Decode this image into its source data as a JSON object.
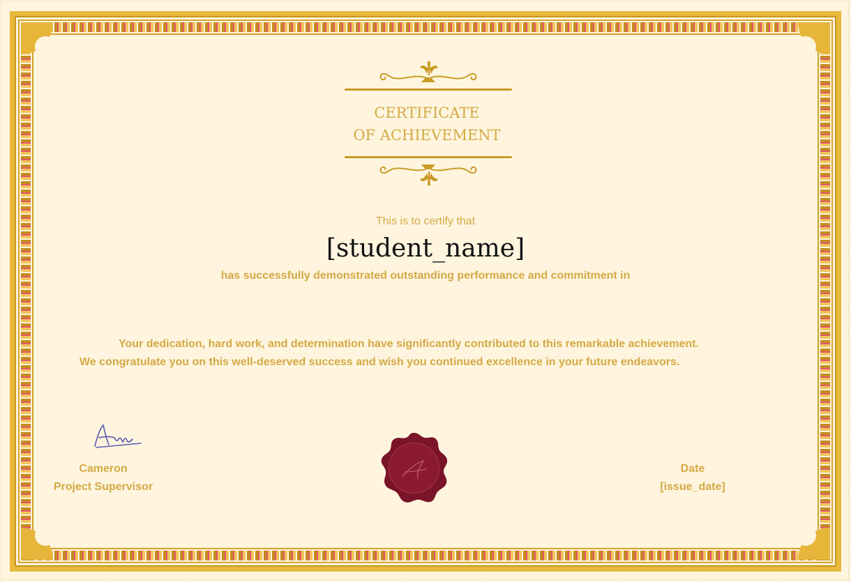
{
  "certificate": {
    "title_line1": "CERTIFICATE",
    "title_line2": "OF ACHIEVEMENT",
    "certify_text": "This is to certify that",
    "student_name": "[student_name]",
    "demonstrated_text": "has successfully demonstrated outstanding performance and commitment in",
    "paragraph_line1": "Your dedication, hard work, and determination have significantly contributed to this remarkable achievement.",
    "paragraph_line2": "We congratulate you on this well-deserved success and wish you continued excellence in your future endeavors."
  },
  "signatory": {
    "name": "Cameron",
    "role": "Project Supervisor"
  },
  "date_block": {
    "label": "Date",
    "value": "[issue_date]"
  },
  "colors": {
    "background": "#fff5df",
    "gold": "#d3a944",
    "frame_gold": "#e8b93a",
    "accent_pink": "#e3556e",
    "seal_red": "#7a1428"
  },
  "icons": [
    "top-ornament-icon",
    "bottom-ornament-icon",
    "signature-icon",
    "wax-seal-icon"
  ]
}
